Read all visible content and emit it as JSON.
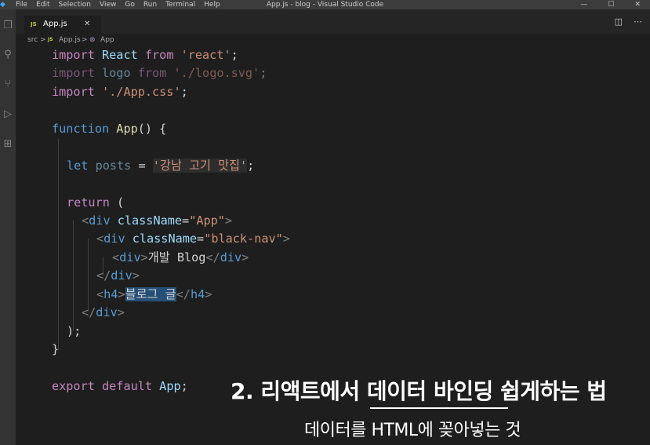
{
  "window": {
    "title": "App.js - blog - Visual Studio Code",
    "menu": [
      "File",
      "Edit",
      "Selection",
      "View",
      "Go",
      "Run",
      "Terminal",
      "Help"
    ],
    "controls": {
      "minimize": "—",
      "maximize": "☐",
      "close": "✕"
    }
  },
  "tab": {
    "badge": "JS",
    "name": "App.js",
    "close": "✕"
  },
  "breadcrumbs": {
    "folder": "src",
    "sep": ">",
    "badge": "JS",
    "file": "App.js",
    "symbol_icon": "⊗",
    "symbol": "App"
  },
  "code": {
    "l1": {
      "a": "import",
      "b": " React ",
      "c": "from",
      "d": " 'react'",
      "e": ";"
    },
    "l2": {
      "a": "import",
      "b": " logo ",
      "c": "from",
      "d": " './logo.svg'",
      "e": ";"
    },
    "l3": {
      "a": "import",
      "b": " './App.css'",
      "c": ";"
    },
    "l4": {
      "a": "function",
      "b": " App",
      "c": "() {"
    },
    "l5": {
      "a": "let",
      "b": " posts ",
      "c": "= ",
      "d": "'강남 고기 맛집'",
      "e": ";"
    },
    "l6": {
      "a": "return",
      "b": " ("
    },
    "l7": {
      "a": "<",
      "b": "div",
      "c": " className",
      "d": "=",
      "e": "\"App\"",
      "f": ">"
    },
    "l8": {
      "a": "<",
      "b": "div",
      "c": " className",
      "d": "=",
      "e": "\"black-nav\"",
      "f": ">"
    },
    "l9": {
      "a": "<",
      "b": "div",
      "c": ">",
      "d": "개발 Blog",
      "e": "</",
      "f": "div",
      "g": ">"
    },
    "l10": {
      "a": "</",
      "b": "div",
      "c": ">"
    },
    "l11": {
      "a": "<",
      "b": "h4",
      "c": ">",
      "d": "블로그 글",
      "e": "</",
      "f": "h4",
      "g": ">"
    },
    "l12": {
      "a": "</",
      "b": "div",
      "c": ">"
    },
    "l13": {
      "a": ");"
    },
    "l14": {
      "a": "}"
    },
    "l15": {
      "a": "export",
      "b": " default",
      "c": " App",
      "d": ";"
    }
  },
  "caption": {
    "title": "2. 리액트에서 데이터 바인딩 쉽게하는 법",
    "subtitle": "데이터를 HTML에 꽂아넣는 것"
  },
  "colors": {
    "keyword": "#569cd6",
    "control": "#c586c0",
    "function": "#dcdcaa",
    "string": "#ce9178",
    "variable": "#9cdcfe"
  }
}
